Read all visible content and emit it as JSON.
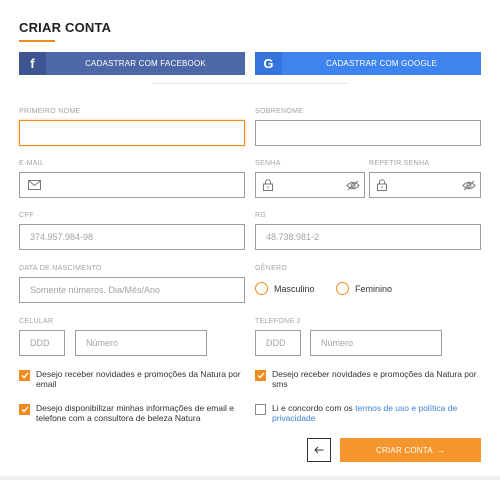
{
  "header": {
    "title": "CRIAR CONTA"
  },
  "social": {
    "facebook_label": "CADASTRAR COM FACEBOOK",
    "facebook_icon_glyph": "f",
    "google_label": "CADASTRAR COM GOOGLE",
    "google_icon_glyph": "G",
    "facebook_color": "#4e67a7",
    "google_color": "#3f84ee"
  },
  "form": {
    "first_name": {
      "label": "PRIMEIRO NOME",
      "value": "",
      "placeholder": ""
    },
    "last_name": {
      "label": "SOBRENOME",
      "value": "",
      "placeholder": ""
    },
    "email": {
      "label": "E-MAIL",
      "value": "",
      "placeholder": "",
      "icon": "envelope-icon"
    },
    "password": {
      "label": "SENHA",
      "value": "",
      "placeholder": "",
      "icons": [
        "lock-icon",
        "eye-off-icon"
      ]
    },
    "password_repeat": {
      "label": "REPETIR SENHA",
      "value": "",
      "placeholder": "",
      "icons": [
        "lock-icon",
        "eye-off-icon"
      ]
    },
    "cpf": {
      "label": "CPF",
      "value": "",
      "placeholder": "374.957.984-98"
    },
    "rg": {
      "label": "RG",
      "value": "",
      "placeholder": "48.738.981-2"
    },
    "birth_date": {
      "label": "DATA DE NASCIMENTO",
      "value": "",
      "placeholder": "Somente números. Dia/Mês/Ano"
    },
    "gender": {
      "label": "GÊNERO",
      "options": [
        "Masculino",
        "Feminino"
      ],
      "selected": null
    },
    "cellphone": {
      "label": "CELULAR",
      "ddd_placeholder": "DDD",
      "number_placeholder": "Número"
    },
    "phone2": {
      "label": "TELEFONE 2",
      "ddd_placeholder": "DDD",
      "number_placeholder": "Número"
    }
  },
  "checks": {
    "newsletter_email": {
      "text": "Desejo receber novidades e promoções da Natura por email",
      "checked": true
    },
    "newsletter_sms": {
      "text": "Desejo receber novidades e promoções da Natura por sms",
      "checked": true
    },
    "share_info": {
      "text": "Desejo disponibilizar minhas informações de email e telefone com a consultora de beleza Natura",
      "checked": true
    },
    "terms": {
      "prefix": "Li e concordo com os ",
      "link": "termos de uso e política de privacidade",
      "checked": false
    }
  },
  "actions": {
    "back_icon": "arrow-left-icon",
    "submit_label": "CRIAR CONTA",
    "submit_arrow": "→"
  },
  "colors": {
    "accent": "#f08b1d",
    "link": "#3c7fd6"
  }
}
